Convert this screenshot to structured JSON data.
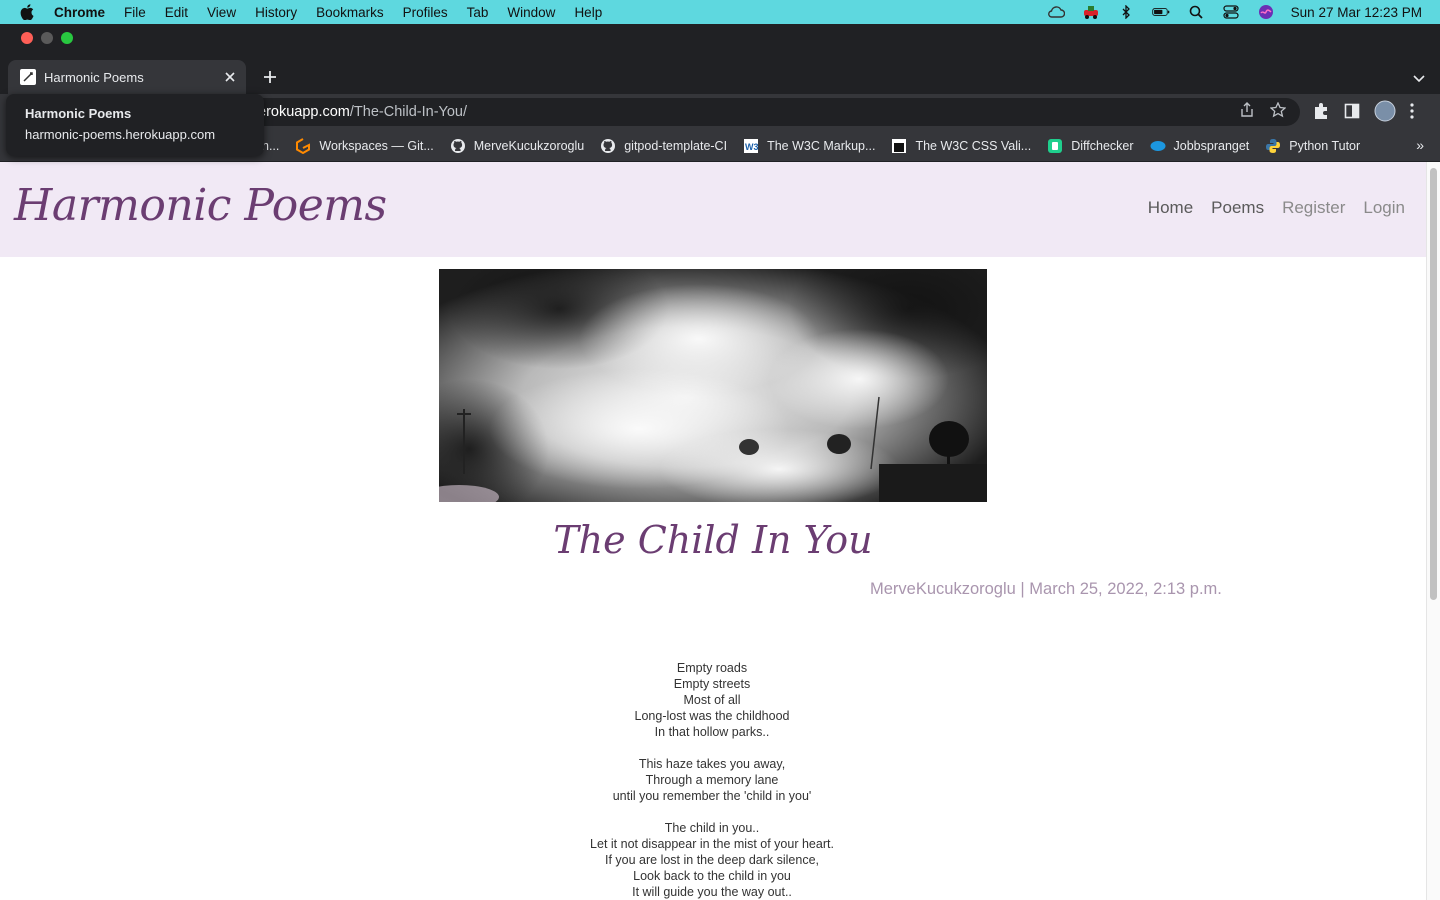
{
  "menubar": {
    "app_name": "Chrome",
    "items": [
      "File",
      "Edit",
      "View",
      "History",
      "Bookmarks",
      "Profiles",
      "Tab",
      "Window",
      "Help"
    ],
    "clock": "Sun 27 Mar  12:23 PM"
  },
  "browser": {
    "tab_title": "Harmonic Poems",
    "url_host_fragment": "erokuapp.com",
    "url_path": "/The-Child-In-You/",
    "tooltip": {
      "title": "Harmonic Poems",
      "host": "harmonic-poems.herokuapp.com"
    },
    "bookmarks": [
      {
        "label": "h...",
        "icon": "bookmark-icon"
      },
      {
        "label": "Workspaces — Git...",
        "icon": "gitpod-icon"
      },
      {
        "label": "MerveKucukzoroglu",
        "icon": "github-icon"
      },
      {
        "label": "gitpod-template-CI",
        "icon": "github-icon"
      },
      {
        "label": "The W3C Markup...",
        "icon": "w3c-icon"
      },
      {
        "label": "The W3C CSS Vali...",
        "icon": "w3c-css-icon"
      },
      {
        "label": "Diffchecker",
        "icon": "diffchecker-icon"
      },
      {
        "label": "Jobbspranget",
        "icon": "salesforce-icon"
      },
      {
        "label": "Python Tutor",
        "icon": "python-icon"
      }
    ],
    "more_bookmarks": "»"
  },
  "site": {
    "brand": "Harmonic Poems",
    "nav": {
      "home": "Home",
      "poems": "Poems",
      "register": "Register",
      "login": "Login"
    },
    "poem": {
      "title": "The Child In You",
      "meta": "MerveKucukzoroglu | March 25, 2022, 2:13 p.m.",
      "stanza1": [
        "Empty roads",
        "Empty streets",
        "Most of all",
        "Long-lost was the childhood",
        "In that hollow parks.."
      ],
      "stanza2": [
        "This haze takes you away,",
        "Through a memory lane",
        "until you remember the 'child in you'"
      ],
      "stanza3": [
        "The child in you..",
        "Let it not disappear in the mist of your heart.",
        "If you are lost in the deep dark silence,",
        "Look back to the child in you",
        "It will guide you the way out.."
      ]
    }
  },
  "colors": {
    "menubar_bg": "#5ed8df",
    "brand_purple": "#6b3d72",
    "navbar_bg": "#f1e9f5",
    "meta_color": "#a995ae"
  }
}
